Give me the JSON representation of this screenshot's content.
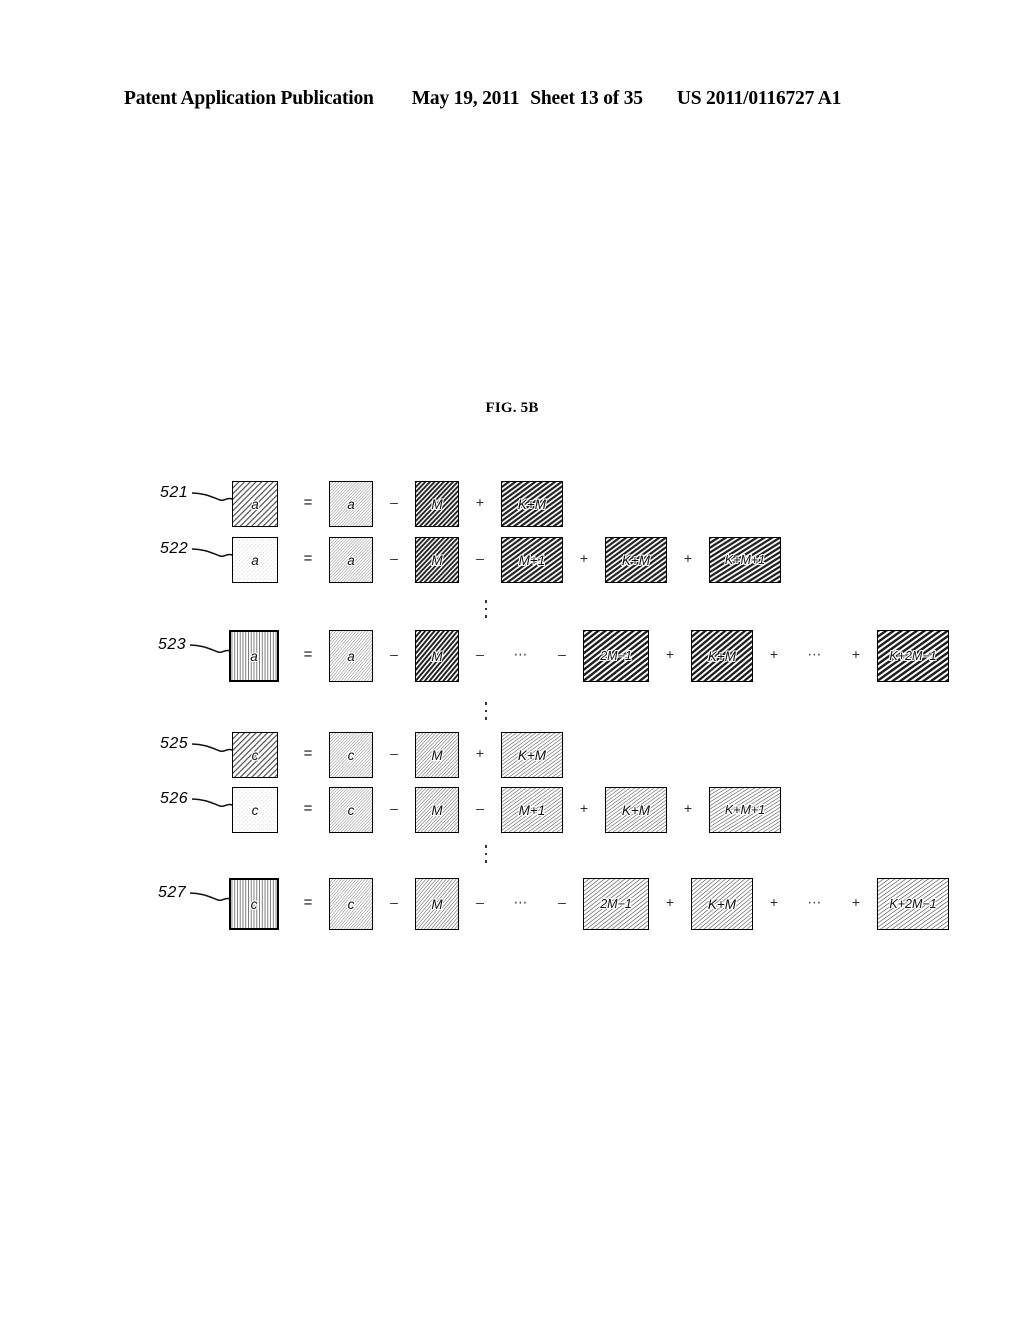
{
  "header": {
    "title": "Patent Application Publication",
    "date": "May 19, 2011",
    "sheet": "Sheet 13 of 35",
    "publication_number": "US 2011/0116727 A1"
  },
  "figure": {
    "caption": "FIG. 5B",
    "operators": {
      "equals": "=",
      "minus": "–",
      "plus": "+",
      "horizontal_ellipsis": "⋯",
      "vertical_ellipsis": "⋮"
    },
    "rows": [
      {
        "ref": "521",
        "result": {
          "label": "a",
          "pattern": "diagonal-medium"
        },
        "terms": [
          {
            "op": "=",
            "label": "a",
            "pattern": "diagonal-fine"
          },
          {
            "op": "–",
            "label": "M",
            "pattern": "diagonal-bold"
          },
          {
            "op": "+",
            "label": "K+M",
            "pattern": "diagonal-bold"
          }
        ]
      },
      {
        "ref": "522",
        "result": {
          "label": "a",
          "pattern": "stipple"
        },
        "terms": [
          {
            "op": "=",
            "label": "a",
            "pattern": "diagonal-fine"
          },
          {
            "op": "–",
            "label": "M",
            "pattern": "diagonal-bold"
          },
          {
            "op": "–",
            "label": "M+1",
            "pattern": "diagonal-bold"
          },
          {
            "op": "+",
            "label": "K+M",
            "pattern": "diagonal-bold"
          },
          {
            "op": "+",
            "label": "K+M+1",
            "pattern": "diagonal-bold"
          }
        ]
      },
      {
        "ref": "523",
        "result": {
          "label": "a",
          "pattern": "vertical-lines"
        },
        "terms": [
          {
            "op": "=",
            "label": "a",
            "pattern": "diagonal-fine"
          },
          {
            "op": "–",
            "label": "M",
            "pattern": "diagonal-bold"
          },
          {
            "op": "–",
            "label": "⋯",
            "pattern": "none"
          },
          {
            "op": "–",
            "label": "2M−1",
            "pattern": "diagonal-bold"
          },
          {
            "op": "+",
            "label": "K+M",
            "pattern": "diagonal-bold"
          },
          {
            "op": "+",
            "label": "⋯",
            "pattern": "none"
          },
          {
            "op": "+",
            "label": "K+2M−1",
            "pattern": "diagonal-bold"
          }
        ]
      },
      {
        "ref": "525",
        "result": {
          "label": "c",
          "pattern": "diagonal-medium"
        },
        "terms": [
          {
            "op": "=",
            "label": "c",
            "pattern": "diagonal-fine"
          },
          {
            "op": "–",
            "label": "M",
            "pattern": "diagonal-light"
          },
          {
            "op": "+",
            "label": "K+M",
            "pattern": "diagonal-light"
          }
        ]
      },
      {
        "ref": "526",
        "result": {
          "label": "c",
          "pattern": "stipple"
        },
        "terms": [
          {
            "op": "=",
            "label": "c",
            "pattern": "diagonal-fine"
          },
          {
            "op": "–",
            "label": "M",
            "pattern": "diagonal-light"
          },
          {
            "op": "–",
            "label": "M+1",
            "pattern": "diagonal-light"
          },
          {
            "op": "+",
            "label": "K+M",
            "pattern": "diagonal-light"
          },
          {
            "op": "+",
            "label": "K+M+1",
            "pattern": "diagonal-light"
          }
        ]
      },
      {
        "ref": "527",
        "result": {
          "label": "c",
          "pattern": "vertical-lines"
        },
        "terms": [
          {
            "op": "=",
            "label": "c",
            "pattern": "diagonal-fine"
          },
          {
            "op": "–",
            "label": "M",
            "pattern": "diagonal-light"
          },
          {
            "op": "–",
            "label": "⋯",
            "pattern": "none"
          },
          {
            "op": "–",
            "label": "2M−1",
            "pattern": "diagonal-light"
          },
          {
            "op": "+",
            "label": "K+M",
            "pattern": "diagonal-light"
          },
          {
            "op": "+",
            "label": "⋯",
            "pattern": "none"
          },
          {
            "op": "+",
            "label": "K+2M−1",
            "pattern": "diagonal-light"
          }
        ]
      }
    ],
    "group_separators": [
      {
        "after_ref": "522"
      },
      {
        "after_ref": "523"
      },
      {
        "after_ref": "526"
      }
    ]
  }
}
